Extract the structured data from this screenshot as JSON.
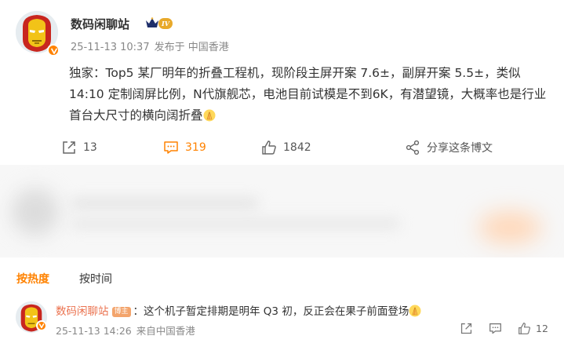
{
  "post": {
    "username": "数码闲聊站",
    "level": "IV",
    "date": "25-11-13 10:37",
    "source": "发布于 中国香港",
    "content": "独家：Top5 某厂明年的折叠工程机，现阶段主屏开案 7.6±，副屏开案 5.5±，类似14:10 定制阔屏比例，N代旗舰芯，电池目前试模是不到6K，有潜望镜，大概率也是行业首台大尺寸的横向阔折叠",
    "actions": {
      "repost": "13",
      "comment": "319",
      "like": "1842",
      "share": "分享这条博文"
    },
    "colors": {
      "accent": "#ff8200",
      "verified": "#ff8200"
    }
  },
  "sort": {
    "hot": "按热度",
    "time": "按时间"
  },
  "comment": {
    "username": "数码闲聊站",
    "tag": "博主",
    "text": "：这个机子暂定排期是明年 Q3 初，反正会在果子前面登场",
    "date": "25-11-13 14:26",
    "source": "来自中国香港",
    "likes": "12"
  },
  "icons": {
    "repost": "repost-icon",
    "comment": "comment-icon",
    "like": "like-icon",
    "share": "share-icon",
    "emoji": "pray-emoji-icon"
  }
}
